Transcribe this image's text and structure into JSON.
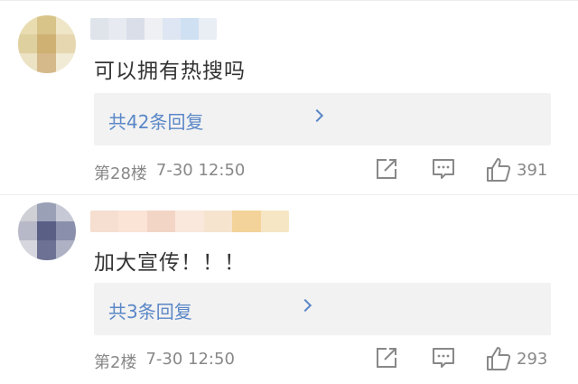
{
  "comments": [
    {
      "text": "可以拥有热搜吗",
      "reply_label": "共42条回复",
      "floor": "第28楼",
      "time": "7-30 12:50",
      "likes": "391"
    },
    {
      "text": "加大宣传！！！",
      "reply_label": "共3条回复",
      "floor": "第2楼",
      "time": "7-30 12:50",
      "likes": "293"
    }
  ],
  "icons": {
    "share": "share-icon",
    "comment": "comment-icon",
    "like": "thumbs-up-icon",
    "reply_more": "chevron-right-icon"
  },
  "colors": {
    "link": "#5a87c7",
    "meta": "#888888",
    "reply_bg": "#f2f2f2"
  }
}
